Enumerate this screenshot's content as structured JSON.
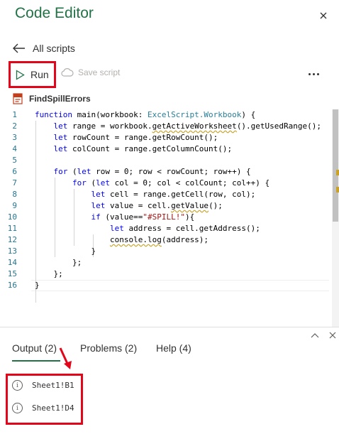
{
  "app": {
    "title": "Code Editor",
    "back_label": "All scripts",
    "run_label": "Run",
    "save_label": "Save script",
    "script_name": "FindSpillErrors"
  },
  "editor": {
    "line_numbers": [
      "1",
      "2",
      "3",
      "4",
      "5",
      "6",
      "7",
      "8",
      "9",
      "10",
      "11",
      "12",
      "13",
      "14",
      "15",
      "16"
    ],
    "lines": [
      "function main(workbook: ExcelScript.Workbook) {",
      "    let range = workbook.getActiveWorksheet().getUsedRange();",
      "    let rowCount = range.getRowCount();",
      "    let colCount = range.getColumnCount();",
      "",
      "    for (let row = 0; row < rowCount; row++) {",
      "        for (let col = 0; col < colCount; col++) {",
      "            let cell = range.getCell(row, col);",
      "            let value = cell.getValue();",
      "            if (value==\"#SPILL!\"){",
      "                let address = cell.getAddress();",
      "                console.log(address);",
      "            }",
      "        };",
      "    };",
      "}"
    ]
  },
  "output_panel": {
    "tabs": [
      {
        "label": "Output (2)"
      },
      {
        "label": "Problems (2)"
      },
      {
        "label": "Help (4)"
      }
    ],
    "results": [
      {
        "text": "Sheet1!B1"
      },
      {
        "text": "Sheet1!D4"
      }
    ]
  },
  "colors": {
    "accent": "#217346",
    "highlight_red": "#e3061b",
    "keyword": "#0000ff",
    "type": "#267f99",
    "string": "#a31515",
    "line_number": "#237893"
  },
  "icons": {
    "close": "close-icon",
    "back": "arrow-left-icon",
    "run": "play-icon",
    "save": "cloud-save-icon",
    "more": "more-icon",
    "script": "script-file-icon",
    "info": "info-icon",
    "panel_expand": "chevron-up-icon",
    "panel_close": "close-icon"
  }
}
